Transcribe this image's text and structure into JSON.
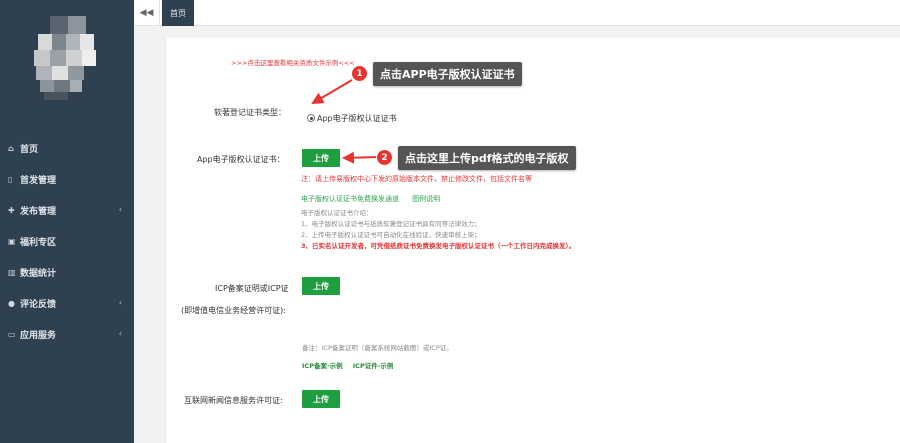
{
  "sidebar": {
    "items": [
      {
        "icon": "home-icon",
        "glyph": "⌂",
        "label": "首页",
        "chevron": false
      },
      {
        "icon": "file-icon",
        "glyph": "▯",
        "label": "首发管理",
        "chevron": false
      },
      {
        "icon": "publish-icon",
        "glyph": "✚",
        "label": "发布管理",
        "chevron": true
      },
      {
        "icon": "gift-icon",
        "glyph": "▣",
        "label": "福利专区",
        "chevron": false
      },
      {
        "icon": "chart-icon",
        "glyph": "▥",
        "label": "数据统计",
        "chevron": false
      },
      {
        "icon": "comment-icon",
        "glyph": "●",
        "label": "评论反馈",
        "chevron": true
      },
      {
        "icon": "monitor-icon",
        "glyph": "▭",
        "label": "应用服务",
        "chevron": true
      }
    ]
  },
  "topbar": {
    "collapse_glyph": "◀◀",
    "tab_home": "首页"
  },
  "form": {
    "sample_link": ">>>点击这里查看相关资质文件示例<<<",
    "cert_type_label": "软著登记证书类型：",
    "cert_type_option": "App电子版权认证证书",
    "app_cert_label": "App电子版权认证证书：",
    "upload_label": "上传",
    "note_red": "注：请上传易版权中心下发的原始版本文件，禁止修改文件，包括文件名等",
    "note_green_1": "电子版权认证证书免费换发通道",
    "note_green_2": "图例说明",
    "intro_title": "电子版权认证证书介绍：",
    "intro_1": "1、电子版权认证证书与纸质软著登记证书具有同等法律效力；",
    "intro_2": "2、上传电子版权认证证书可自动化在线验证，快速审核上架；",
    "intro_3": "3、已实名认证开发者，可凭借纸质证书免费换发电子版权认证证书（一个工作日内完成换发）。",
    "icp_label_1": "ICP备案证明或ICP证",
    "icp_label_2": "(即增值电信业务经营许可证):",
    "icp_note": "备注：ICP备案证明（备案系统网站截图）或ICP证。",
    "icp_example_1": "ICP备案-示例",
    "icp_example_2": "ICP证件-示例",
    "news_label": "互联网新闻信息服务许可证:"
  },
  "callouts": {
    "one_num": "1",
    "one_text": "点击APP电子版权认证证书",
    "two_num": "2",
    "two_text": "点击这里上传pdf格式的电子版权"
  },
  "colors": {
    "sidebar": "#2f4050",
    "upload_green": "#1e9e3e",
    "badge_red": "#e8322f",
    "callout_gray": "#555555"
  }
}
